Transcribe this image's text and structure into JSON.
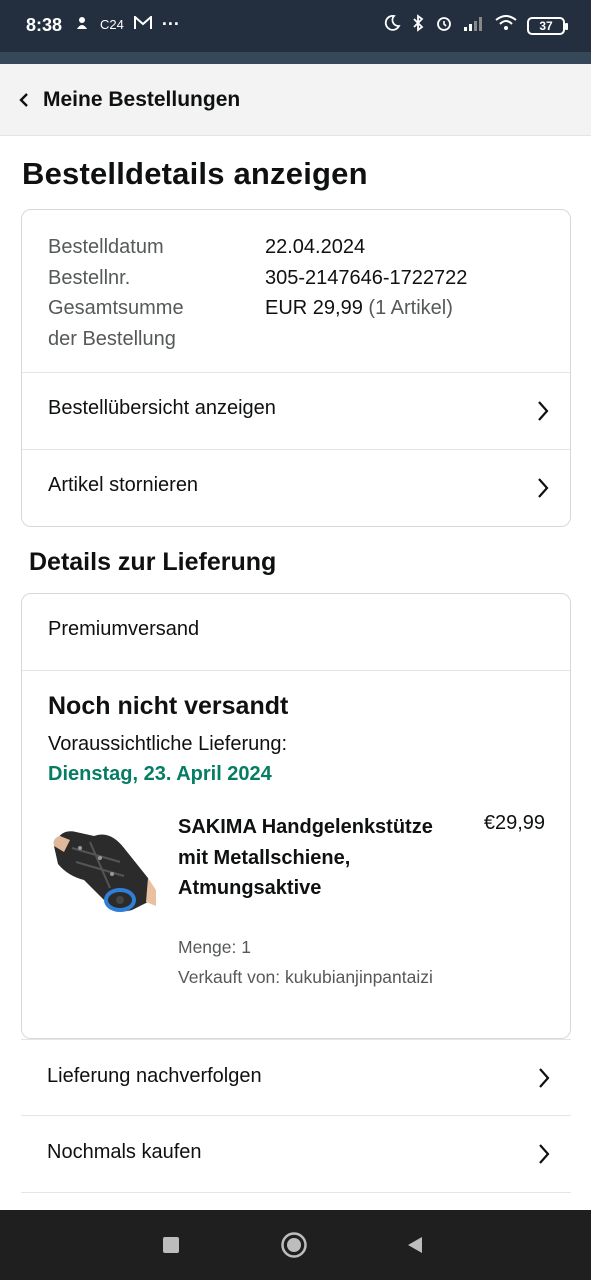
{
  "status_bar": {
    "time": "8:38",
    "left_icons": [
      "c24-icon",
      "gmail-icon",
      "more-dots-icon"
    ],
    "c24_label": "C24",
    "more_label": "···",
    "battery": "37"
  },
  "nav": {
    "back_label": "Meine Bestellungen"
  },
  "page_title": "Bestelldetails anzeigen",
  "order_summary": {
    "rows": [
      {
        "label": "Bestelldatum",
        "value": "22.04.2024"
      },
      {
        "label": "Bestellnr.",
        "value": "305-2147646-1722722"
      },
      {
        "label": "Gesamtsumme der Bestellung",
        "value": "EUR 29,99",
        "value_suffix": "(1 Artikel)"
      }
    ],
    "total_label_line1": "Gesamtsumme",
    "total_label_line2": "der Bestellung"
  },
  "order_links": [
    {
      "label": "Bestellübersicht anzeigen"
    },
    {
      "label": "Artikel stornieren"
    }
  ],
  "delivery": {
    "section_title": "Details zur Lieferung",
    "shipping_method": "Premiumversand",
    "status": "Noch nicht versandt",
    "eta_label": "Voraussichtliche Lieferung:",
    "eta_date": "Dienstag, 23. April 2024",
    "eta_color": "#067d62",
    "item": {
      "title": "SAKIMA Handgelenkstütze mit Metallschiene, Atmungsaktive",
      "price": "€29,99",
      "quantity": "Menge: 1",
      "seller": "Verkauft von: kukubianjinpantaizi"
    }
  },
  "delivery_links": [
    {
      "label": "Lieferung nachverfolgen"
    },
    {
      "label": "Nochmals kaufen"
    }
  ],
  "colors": {
    "status_bar": "#232f3e",
    "header_bg": "#f3f3f3",
    "text": "#0f1111",
    "muted": "#565959",
    "border": "#d5d9d9"
  }
}
